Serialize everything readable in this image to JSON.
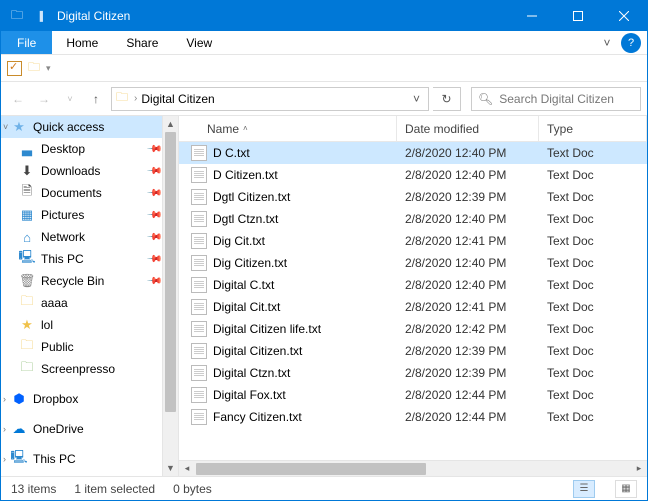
{
  "window": {
    "title": "Digital Citizen"
  },
  "menu": {
    "file": "File",
    "home": "Home",
    "share": "Share",
    "view": "View"
  },
  "address": {
    "crumb": "Digital Citizen",
    "search_placeholder": "Search Digital Citizen"
  },
  "columns": {
    "name": "Name",
    "date": "Date modified",
    "type": "Type"
  },
  "sidebar": {
    "items": [
      {
        "label": "Quick access",
        "icon": "★",
        "cls": "ic-star",
        "top": true,
        "caret": "v",
        "quick": true
      },
      {
        "label": "Desktop",
        "icon": "▃",
        "cls": "ic-desktop",
        "pin": true
      },
      {
        "label": "Downloads",
        "icon": "⬇",
        "cls": "ic-down",
        "pin": true
      },
      {
        "label": "Documents",
        "icon": "🗎",
        "cls": "ic-doc",
        "pin": true
      },
      {
        "label": "Pictures",
        "icon": "▦",
        "cls": "ic-pic",
        "pin": true
      },
      {
        "label": "Network",
        "icon": "⌂",
        "cls": "ic-net",
        "pin": true
      },
      {
        "label": "This PC",
        "icon": "🖳",
        "cls": "ic-pc",
        "pin": true
      },
      {
        "label": "Recycle Bin",
        "icon": "🗑",
        "cls": "ic-bin",
        "pin": true
      },
      {
        "label": "aaaa",
        "icon": "🗀",
        "cls": "ic-yf"
      },
      {
        "label": "lol",
        "icon": "★",
        "cls": "ic-yst"
      },
      {
        "label": "Public",
        "icon": "🗀",
        "cls": "ic-yf"
      },
      {
        "label": "Screenpresso",
        "icon": "🗀",
        "cls": "ic-gf"
      },
      {
        "label": "",
        "spaceronly": true
      },
      {
        "label": "Dropbox",
        "icon": "⬢",
        "cls": "ic-db",
        "top": true,
        "caret": ">"
      },
      {
        "label": "",
        "spaceronly": true
      },
      {
        "label": "OneDrive",
        "icon": "☁",
        "cls": "ic-od",
        "top": true,
        "caret": ">"
      },
      {
        "label": "",
        "spaceronly": true
      },
      {
        "label": "This PC",
        "icon": "🖳",
        "cls": "ic-pc",
        "top": true,
        "caret": ">"
      }
    ]
  },
  "files": [
    {
      "name": "D C.txt",
      "date": "2/8/2020 12:40 PM",
      "type": "Text Doc",
      "sel": true
    },
    {
      "name": "D Citizen.txt",
      "date": "2/8/2020 12:40 PM",
      "type": "Text Doc"
    },
    {
      "name": "Dgtl Citizen.txt",
      "date": "2/8/2020 12:39 PM",
      "type": "Text Doc"
    },
    {
      "name": "Dgtl Ctzn.txt",
      "date": "2/8/2020 12:40 PM",
      "type": "Text Doc"
    },
    {
      "name": "Dig Cit.txt",
      "date": "2/8/2020 12:41 PM",
      "type": "Text Doc"
    },
    {
      "name": "Dig Citizen.txt",
      "date": "2/8/2020 12:40 PM",
      "type": "Text Doc"
    },
    {
      "name": "Digital C.txt",
      "date": "2/8/2020 12:40 PM",
      "type": "Text Doc"
    },
    {
      "name": "Digital Cit.txt",
      "date": "2/8/2020 12:41 PM",
      "type": "Text Doc"
    },
    {
      "name": "Digital Citizen life.txt",
      "date": "2/8/2020 12:42 PM",
      "type": "Text Doc"
    },
    {
      "name": "Digital Citizen.txt",
      "date": "2/8/2020 12:39 PM",
      "type": "Text Doc"
    },
    {
      "name": "Digital Ctzn.txt",
      "date": "2/8/2020 12:39 PM",
      "type": "Text Doc"
    },
    {
      "name": "Digital Fox.txt",
      "date": "2/8/2020 12:44 PM",
      "type": "Text Doc"
    },
    {
      "name": "Fancy Citizen.txt",
      "date": "2/8/2020 12:44 PM",
      "type": "Text Doc"
    }
  ],
  "status": {
    "count": "13 items",
    "sel": "1 item selected",
    "size": "0 bytes"
  }
}
